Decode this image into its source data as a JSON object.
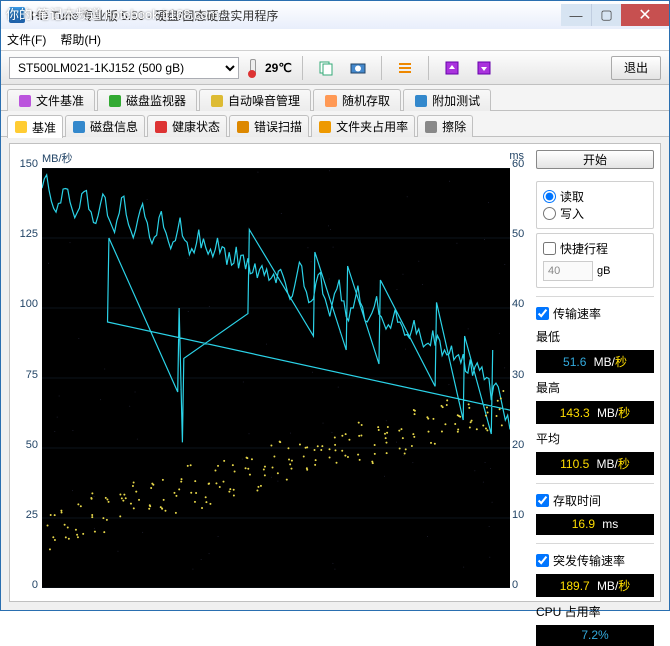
{
  "watermark": "你的•笔记本频道 notebook.it168.com",
  "window": {
    "title": "HD Tune 专业版 5.50 - 硬盘/固态硬盘实用程序"
  },
  "menu": {
    "file": "文件(F)",
    "help": "帮助(H)"
  },
  "toolbar": {
    "drive": "ST500LM021-1KJ152 (500 gB)",
    "temp": "29℃",
    "exit": "退出"
  },
  "tabs_row1": [
    {
      "label": "文件基准",
      "icon": "file-bench"
    },
    {
      "label": "磁盘监视器",
      "icon": "disk-monitor"
    },
    {
      "label": "自动噪音管理",
      "icon": "aam"
    },
    {
      "label": "随机存取",
      "icon": "random"
    },
    {
      "label": "附加测试",
      "icon": "extra"
    }
  ],
  "tabs_row2": [
    {
      "label": "基准",
      "icon": "benchmark",
      "active": true
    },
    {
      "label": "磁盘信息",
      "icon": "info"
    },
    {
      "label": "健康状态",
      "icon": "health"
    },
    {
      "label": "错误扫描",
      "icon": "error"
    },
    {
      "label": "文件夹占用率",
      "icon": "folder"
    },
    {
      "label": "擦除",
      "icon": "erase"
    }
  ],
  "chart": {
    "left_unit": "MB/秒",
    "right_unit": "ms"
  },
  "side": {
    "start": "开始",
    "read": "读取",
    "write": "写入",
    "shortstroke": "快捷行程",
    "shortstroke_val": "40",
    "shortstroke_unit": "gB",
    "transfer_rate": "传输速率",
    "min_label": "最低",
    "min_val": "51.6",
    "min_unit_a": "MB/",
    "min_unit_b": "秒",
    "max_label": "最高",
    "max_val": "143.3",
    "avg_label": "平均",
    "avg_val": "110.5",
    "access_time": "存取时间",
    "access_val": "16.9",
    "access_unit": "ms",
    "burst": "突发传输速率",
    "burst_val": "189.7",
    "cpu": "CPU 占用率",
    "cpu_val": "7.2%"
  },
  "chart_data": {
    "type": "line+scatter",
    "title": "",
    "xlabel": "",
    "ylabel_left": "MB/秒",
    "ylabel_right": "ms",
    "ylim_left": [
      0,
      150
    ],
    "ylim_right": [
      0,
      60
    ],
    "y_ticks_left": [
      0,
      25,
      50,
      75,
      100,
      125,
      150
    ],
    "y_ticks_right": [
      0,
      10,
      20,
      30,
      40,
      50,
      60
    ],
    "x_range_pct": [
      0,
      100
    ],
    "series": [
      {
        "name": "transfer_rate_MBps",
        "axis": "left",
        "style": "line-cyan",
        "x_pct": [
          0,
          2,
          4,
          6,
          8,
          10,
          12,
          14,
          16,
          18,
          20,
          22,
          24,
          26,
          28,
          30,
          32,
          34,
          36,
          38,
          40,
          42,
          44,
          46,
          48,
          50,
          52,
          54,
          56,
          58,
          60,
          62,
          64,
          66,
          68,
          70,
          72,
          74,
          76,
          78,
          80,
          82,
          84,
          86,
          88,
          90,
          92,
          94,
          96,
          98,
          100
        ],
        "values": [
          143,
          138,
          140,
          136,
          139,
          134,
          137,
          131,
          135,
          130,
          133,
          128,
          130,
          125,
          128,
          122,
          125,
          120,
          123,
          118,
          120,
          115,
          117,
          112,
          114,
          110,
          108,
          112,
          105,
          108,
          102,
          105,
          100,
          103,
          98,
          100,
          95,
          97,
          92,
          94,
          88,
          90,
          85,
          87,
          80,
          82,
          76,
          78,
          70,
          65,
          60
        ]
      },
      {
        "name": "dips_MBps",
        "axis": "left",
        "style": "spikes-down",
        "points": [
          [
            14,
            95
          ],
          [
            29,
            70
          ],
          [
            30,
            52
          ],
          [
            44,
            98
          ],
          [
            58,
            90
          ],
          [
            65,
            85
          ],
          [
            72,
            80
          ],
          [
            84,
            72
          ],
          [
            90,
            60
          ],
          [
            96,
            55
          ]
        ]
      },
      {
        "name": "access_time_ms",
        "axis": "right",
        "style": "scatter-yellow",
        "points_sample": [
          [
            2,
            8
          ],
          [
            5,
            9
          ],
          [
            8,
            10
          ],
          [
            11,
            11
          ],
          [
            14,
            10
          ],
          [
            17,
            12
          ],
          [
            20,
            13
          ],
          [
            23,
            12
          ],
          [
            26,
            14
          ],
          [
            29,
            13
          ],
          [
            32,
            15
          ],
          [
            35,
            14
          ],
          [
            38,
            16
          ],
          [
            41,
            15
          ],
          [
            44,
            17
          ],
          [
            47,
            16
          ],
          [
            50,
            18
          ],
          [
            53,
            17
          ],
          [
            56,
            19
          ],
          [
            59,
            18
          ],
          [
            62,
            20
          ],
          [
            65,
            19
          ],
          [
            68,
            21
          ],
          [
            71,
            20
          ],
          [
            74,
            22
          ],
          [
            77,
            21
          ],
          [
            80,
            23
          ],
          [
            83,
            22
          ],
          [
            86,
            24
          ],
          [
            89,
            23
          ],
          [
            92,
            25
          ],
          [
            95,
            24
          ],
          [
            98,
            26
          ]
        ]
      }
    ]
  }
}
